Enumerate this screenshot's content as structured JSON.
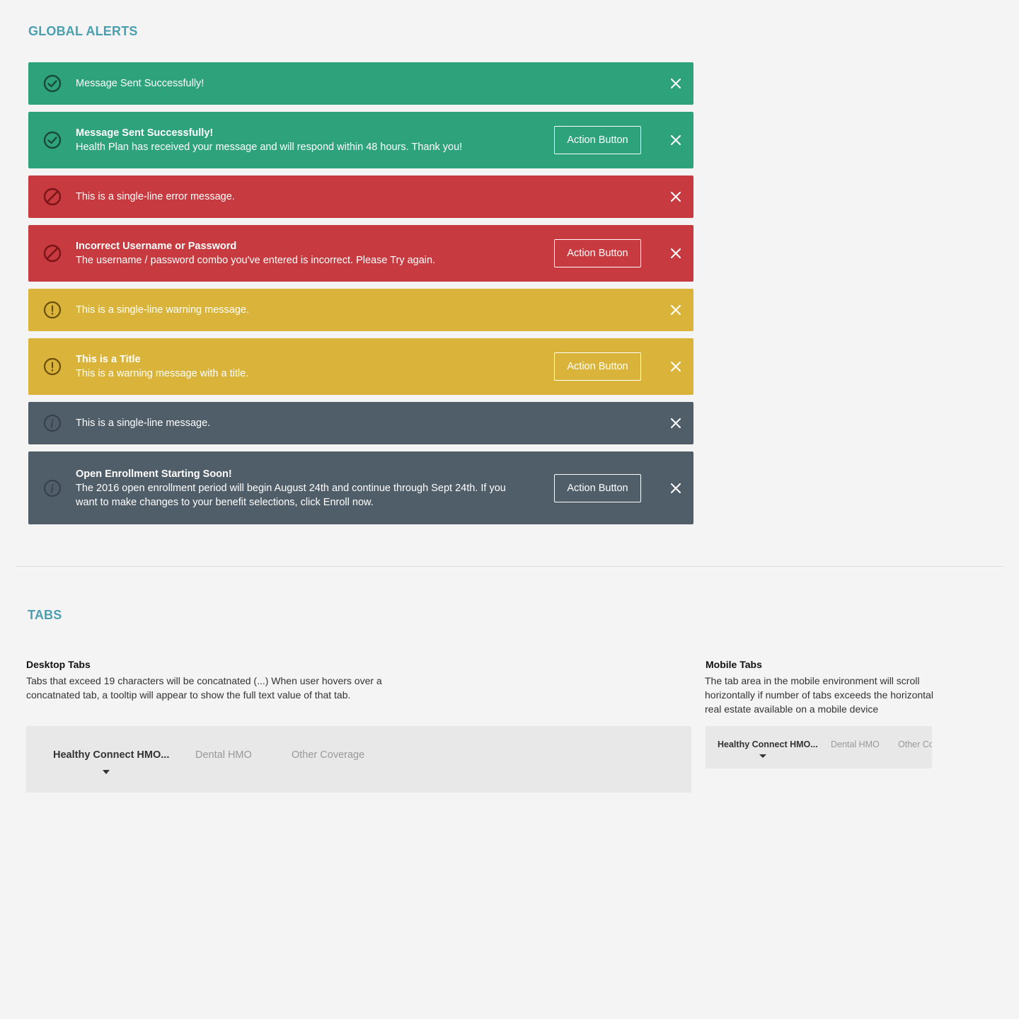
{
  "global_alerts": {
    "title": "GLOBAL ALERTS",
    "colors": {
      "success": "#2ea27b",
      "error": "#c73a3f",
      "warning": "#dab43a",
      "info": "#505e69"
    },
    "alerts": [
      {
        "type": "success",
        "icon": "check-circle-icon",
        "title": "",
        "message": "Message Sent Successfully!",
        "action": ""
      },
      {
        "type": "success",
        "icon": "check-circle-icon",
        "title": "Message Sent Successfully!",
        "message": "Health Plan has received your message and will respond within 48 hours. Thank you!",
        "action": "Action Button"
      },
      {
        "type": "error",
        "icon": "prohibited-icon",
        "title": "",
        "message": "This is a single-line error message.",
        "action": ""
      },
      {
        "type": "error",
        "icon": "prohibited-icon",
        "title": "Incorrect Username or Password",
        "message": "The username / password combo you've entered is incorrect. Please Try again.",
        "action": "Action Button"
      },
      {
        "type": "warning",
        "icon": "exclamation-circle-icon",
        "title": "",
        "message": "This is a single-line warning message.",
        "action": ""
      },
      {
        "type": "warning",
        "icon": "exclamation-circle-icon",
        "title": "This is a Title",
        "message": "This is a warning message with a title.",
        "action": "Action Button"
      },
      {
        "type": "info",
        "icon": "info-circle-icon",
        "title": "",
        "message": "This is a single-line message.",
        "action": ""
      },
      {
        "type": "info",
        "icon": "info-circle-icon",
        "title": "Open Enrollment Starting Soon!",
        "message": "The 2016 open enrollment period will begin  August 24th and continue through Sept 24th. If you want to make changes to your benefit selections, click Enroll now.",
        "action": "Action Button"
      }
    ]
  },
  "tabs_section": {
    "title": "TABS",
    "desktop": {
      "heading": "Desktop Tabs",
      "description": "Tabs that exceed 19 characters will be concatnated (...) When user hovers over a concatnated tab, a tooltip will appear to show the full text value of that tab.",
      "tabs": [
        "Healthy Connect HMO...",
        "Dental HMO",
        "Other Coverage"
      ],
      "active_index": 0
    },
    "mobile": {
      "heading": "Mobile Tabs",
      "description": "The tab area in the mobile environment will scroll horizontally if number of tabs exceeds the horizontal real estate available on a mobile device",
      "tabs": [
        "Healthy Connect HMO...",
        "Dental HMO",
        "Other Coverage"
      ],
      "active_index": 0
    }
  }
}
